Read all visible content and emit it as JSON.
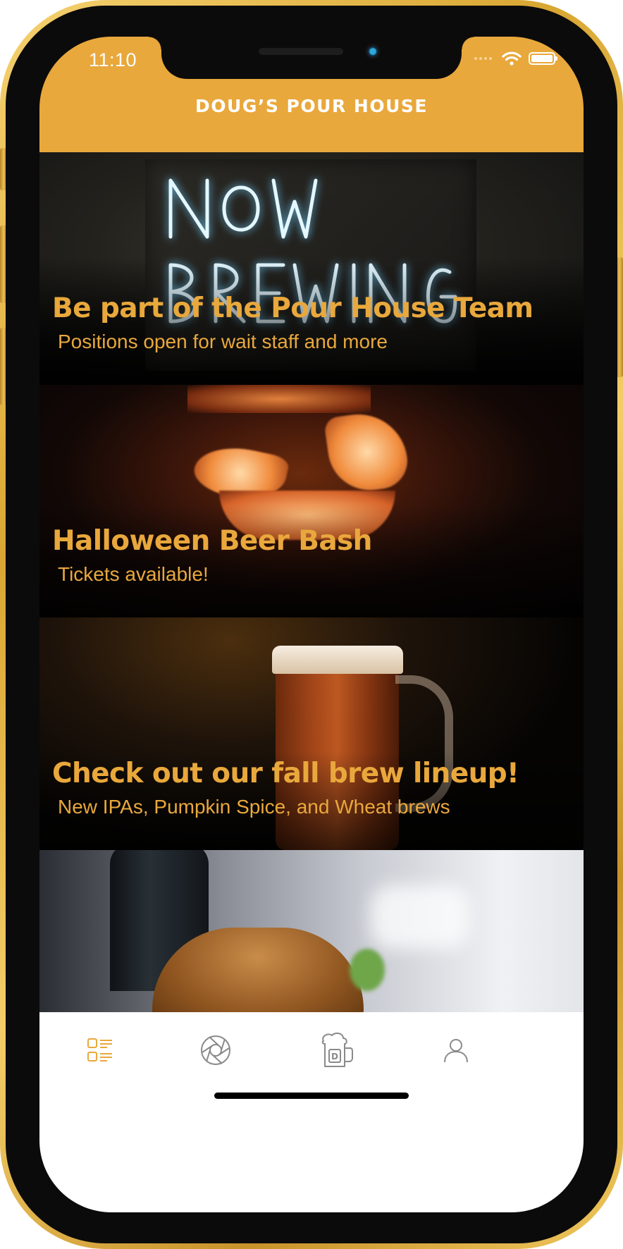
{
  "status_bar": {
    "time": "11:10"
  },
  "header": {
    "title": "DOUG’S POUR HOUSE"
  },
  "feed": {
    "cards": [
      {
        "title": "Be part of the Pour House Team",
        "subtitle": "Positions open for wait staff and more",
        "image_text": "NOW BREWING"
      },
      {
        "title": "Halloween Beer Bash",
        "subtitle": "Tickets available!"
      },
      {
        "title": "Check out our fall brew lineup!",
        "subtitle": "New IPAs, Pumpkin Spice, and Wheat brews"
      },
      {
        "title": "",
        "subtitle": ""
      }
    ]
  },
  "tab_bar": {
    "items": [
      {
        "icon": "feed-list-icon",
        "active": true
      },
      {
        "icon": "camera-aperture-icon",
        "active": false
      },
      {
        "icon": "beer-mug-icon",
        "active": false,
        "badge_letter": "D"
      },
      {
        "icon": "profile-icon",
        "active": false
      }
    ]
  },
  "colors": {
    "brand": "#e9a83c",
    "tab_active": "#e9a83c",
    "tab_inactive": "#8a8a8a"
  }
}
